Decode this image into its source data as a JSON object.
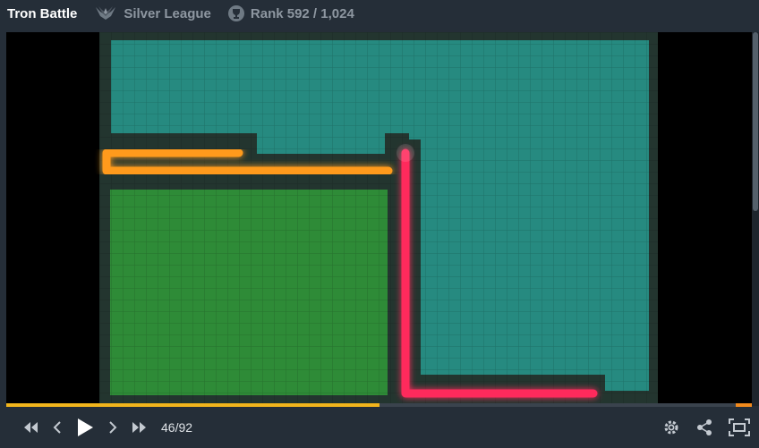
{
  "header": {
    "title": "Tron Battle",
    "league_icon": "laurel-league-icon",
    "league": "Silver League",
    "rank_icon": "trophy-icon",
    "rank": "Rank 592 / 1,024"
  },
  "game": {
    "colors": {
      "background": "#000000",
      "arena_dark": "#23352f",
      "teal_territory": "#268a80",
      "green_territory": "#2e8b37",
      "orange_trail": "#ff9a1a",
      "pink_trail": "#ff2b5c"
    }
  },
  "player": {
    "current_frame": 46,
    "total_frames": 92,
    "frame_label": "46/92",
    "controls": [
      "rewind-icon",
      "step-back-icon",
      "play-icon",
      "step-forward-icon",
      "fast-forward-icon"
    ],
    "right_controls": [
      "settings-icon",
      "share-icon",
      "fullscreen-icon"
    ]
  }
}
